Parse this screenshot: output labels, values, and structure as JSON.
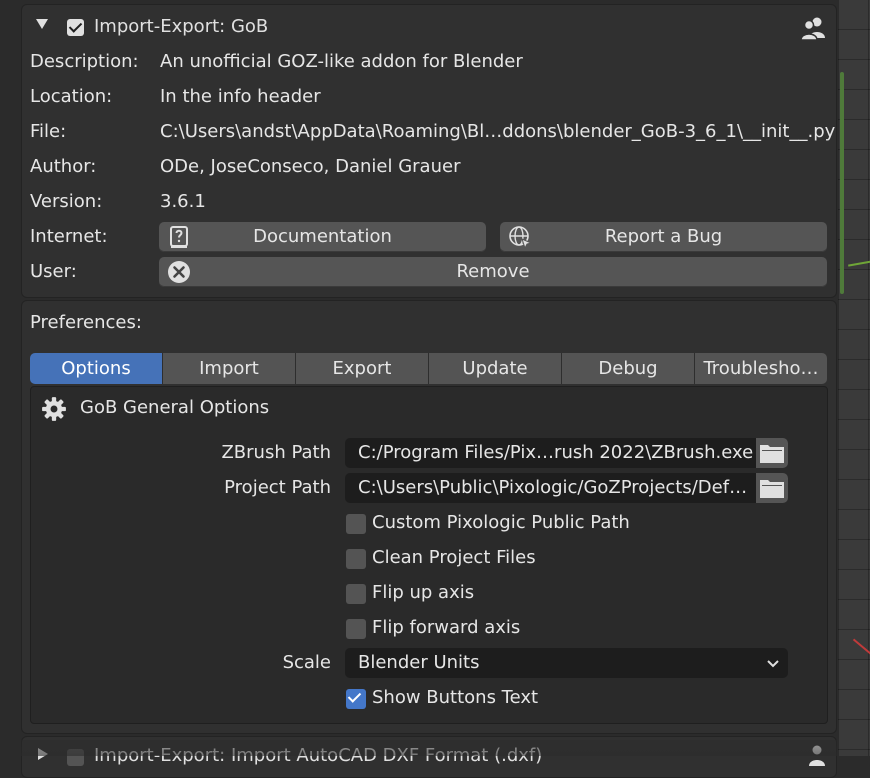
{
  "addon": {
    "title": "Import-Export: GoB",
    "enabled": true,
    "description_label": "Description:",
    "description": "An unofficial GOZ-like addon for Blender",
    "location_label": "Location:",
    "location": "In the info header",
    "file_label": "File:",
    "file": "C:\\Users\\andst\\AppData\\Roaming\\Bl…ddons\\blender_GoB-3_6_1\\__init__.py",
    "author_label": "Author:",
    "author": "ODe, JoseConseco, Daniel Grauer",
    "version_label": "Version:",
    "version": "3.6.1",
    "internet_label": "Internet:",
    "documentation_button": "Documentation",
    "report_bug_button": "Report a Bug",
    "user_label": "User:",
    "remove_button": "Remove"
  },
  "preferences": {
    "label": "Preferences:",
    "tabs": [
      "Options",
      "Import",
      "Export",
      "Update",
      "Debug",
      "Troublesho…"
    ],
    "active_tab": "Options",
    "section_title": "GoB General Options",
    "zbrush_path_label": "ZBrush Path",
    "zbrush_path_value": "C:/Program Files/Pix…rush 2022\\ZBrush.exe",
    "project_path_label": "Project Path",
    "project_path_value": "C:\\Users\\Public\\Pixologic/GoZProjects/Def…",
    "options": [
      {
        "label": "Custom Pixologic Public Path",
        "checked": false
      },
      {
        "label": "Clean Project Files",
        "checked": false
      },
      {
        "label": "Flip up axis",
        "checked": false
      },
      {
        "label": "Flip forward axis",
        "checked": false
      }
    ],
    "scale_label": "Scale",
    "scale_value": "Blender Units",
    "show_buttons_text_label": "Show Buttons Text",
    "show_buttons_text_checked": true
  },
  "next_addon": {
    "title": "Import-Export: Import AutoCAD DXF Format (.dxf)"
  }
}
